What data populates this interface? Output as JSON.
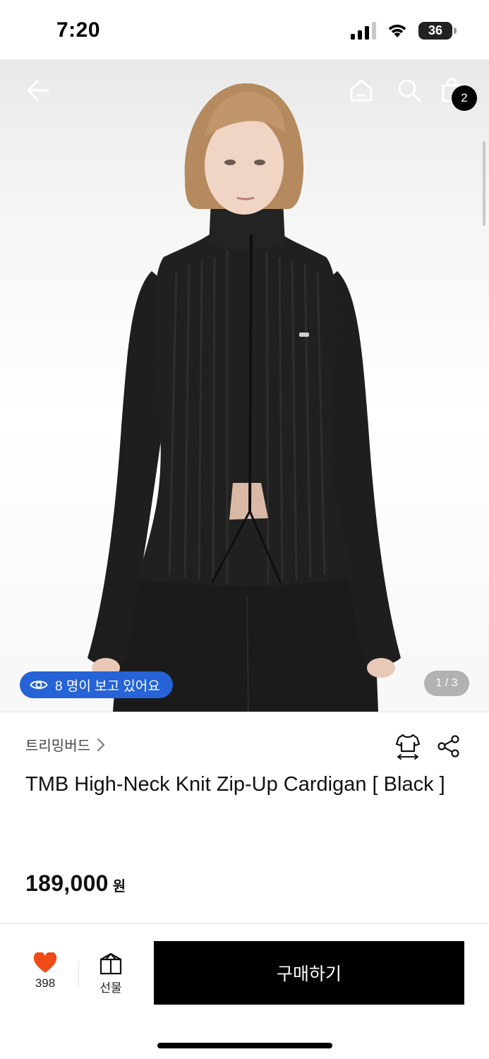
{
  "status": {
    "time": "7:20",
    "battery": "36"
  },
  "nav": {
    "cart_count": "2"
  },
  "hero": {
    "viewers_text": "8 명이 보고 있어요",
    "page_indicator": "1 / 3"
  },
  "product": {
    "brand": "트리밍버드",
    "brand_chevron": ">",
    "title": "TMB High-Neck Knit Zip-Up Cardigan [ Black ]",
    "price": "189,000",
    "currency": "원"
  },
  "actions": {
    "like_count": "398",
    "gift_label": "선물",
    "buy_label": "구매하기"
  },
  "colors": {
    "accent_blue": "#2563d6",
    "like_red": "#f04a16",
    "buy_bg": "#000000"
  }
}
